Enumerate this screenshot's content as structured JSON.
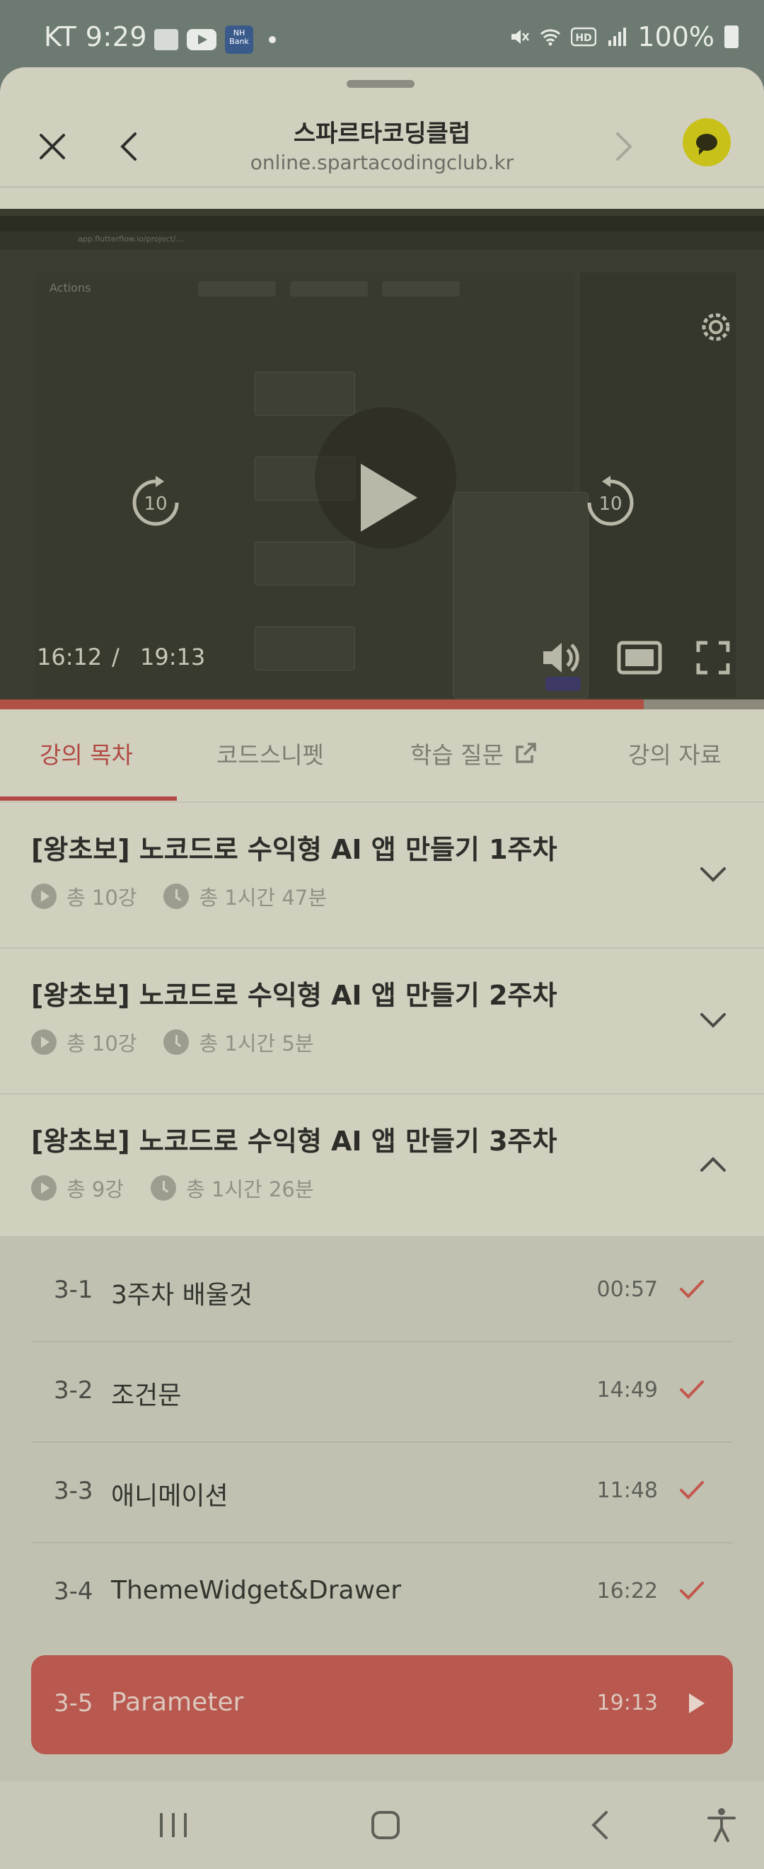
{
  "status_bar": {
    "carrier_time": "KT 9:29",
    "bank_badge": "NH Bank",
    "battery": "100%"
  },
  "browser": {
    "site_title": "스파르타코딩클럽",
    "site_url": "online.spartacodingclub.kr"
  },
  "video": {
    "current_time": "16:12",
    "separator": "/",
    "duration": "19:13",
    "progress": 0.843,
    "skip_back_seconds": "10",
    "skip_forward_seconds": "10",
    "screen_panel_title": "Actions",
    "screen_url": "app.flutterflow.io/project/..."
  },
  "tabs": [
    {
      "label": "강의 목차",
      "active": true
    },
    {
      "label": "코드스니펫",
      "active": false
    },
    {
      "label": "학습 질문",
      "active": false
    },
    {
      "label": "강의 자료",
      "active": false
    }
  ],
  "weeks": [
    {
      "title": "[왕초보] 노코드로 수익형 AI 앱 만들기 1주차",
      "lectures": "총 10강",
      "duration": "총 1시간 47분",
      "expanded": false
    },
    {
      "title": "[왕초보] 노코드로 수익형 AI 앱 만들기 2주차",
      "lectures": "총 10강",
      "duration": "총 1시간 5분",
      "expanded": false
    },
    {
      "title": "[왕초보] 노코드로 수익형 AI 앱 만들기 3주차",
      "lectures": "총 9강",
      "duration": "총 1시간 26분",
      "expanded": true
    }
  ],
  "lessons": [
    {
      "num": "3-1",
      "title": "3주차 배울것",
      "time": "00:57",
      "status": "done"
    },
    {
      "num": "3-2",
      "title": "조건문",
      "time": "14:49",
      "status": "done"
    },
    {
      "num": "3-3",
      "title": "애니메이션",
      "time": "11:48",
      "status": "done"
    },
    {
      "num": "3-4",
      "title": "ThemeWidget&Drawer",
      "time": "16:22",
      "status": "done"
    },
    {
      "num": "3-5",
      "title": "Parameter",
      "time": "19:13",
      "status": "playing"
    }
  ],
  "colors": {
    "accent": "#b14a43",
    "check": "#c2574c",
    "chat_button": "#c8c11a"
  }
}
